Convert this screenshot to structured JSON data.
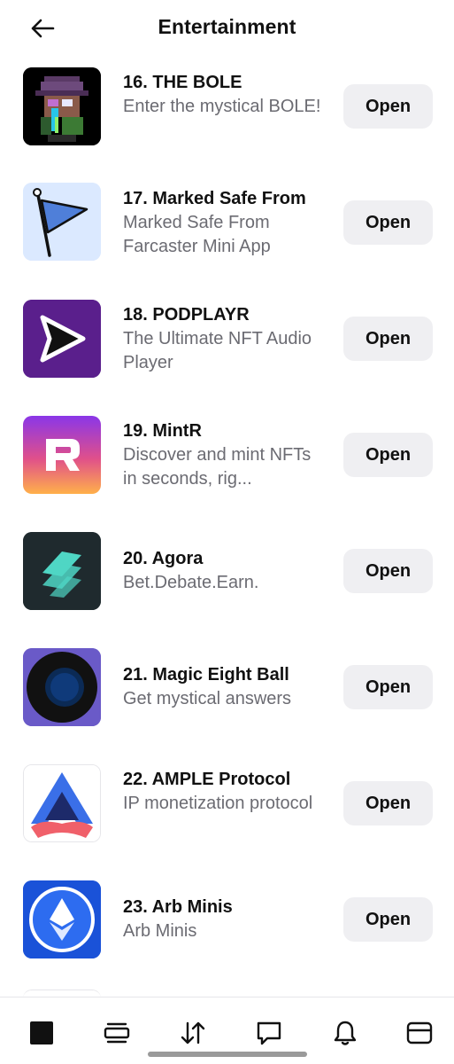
{
  "header": {
    "title": "Entertainment",
    "back_icon": "arrow-left-icon"
  },
  "apps": [
    {
      "name": "16. THE BOLE",
      "description": "Enter the mystical BOLE!",
      "button": "Open",
      "icon": "pixel-wizard-avatar"
    },
    {
      "name": "17. Marked Safe From",
      "description": "Marked Safe From Farcaster Mini App",
      "button": "Open",
      "icon": "blue-flag-icon"
    },
    {
      "name": "18. PODPLAYR",
      "description": "The Ultimate NFT Audio Player",
      "button": "Open",
      "icon": "play-triangle-icon"
    },
    {
      "name": "19. MintR",
      "description": "Discover and mint NFTs in seconds, rig...",
      "button": "Open",
      "icon": "letter-r-logo"
    },
    {
      "name": "20. Agora",
      "description": "Bet.Debate.Earn.",
      "button": "Open",
      "icon": "agora-logo"
    },
    {
      "name": "21. Magic Eight Ball",
      "description": "Get mystical answers",
      "button": "Open",
      "icon": "eight-ball-icon"
    },
    {
      "name": "22. AMPLE Protocol",
      "description": "IP monetization protocol",
      "button": "Open",
      "icon": "ample-logo"
    },
    {
      "name": "23. Arb Minis",
      "description": "Arb Minis",
      "button": "Open",
      "icon": "ethereum-logo"
    }
  ],
  "tabbar": {
    "items": [
      "home-square-icon",
      "cards-stack-icon",
      "swap-arrows-icon",
      "chat-bubble-icon",
      "bell-icon",
      "wallet-icon"
    ]
  },
  "colors": {
    "accent_text": "#111111",
    "secondary_text": "#6b6b72",
    "button_bg": "#efeff2"
  }
}
